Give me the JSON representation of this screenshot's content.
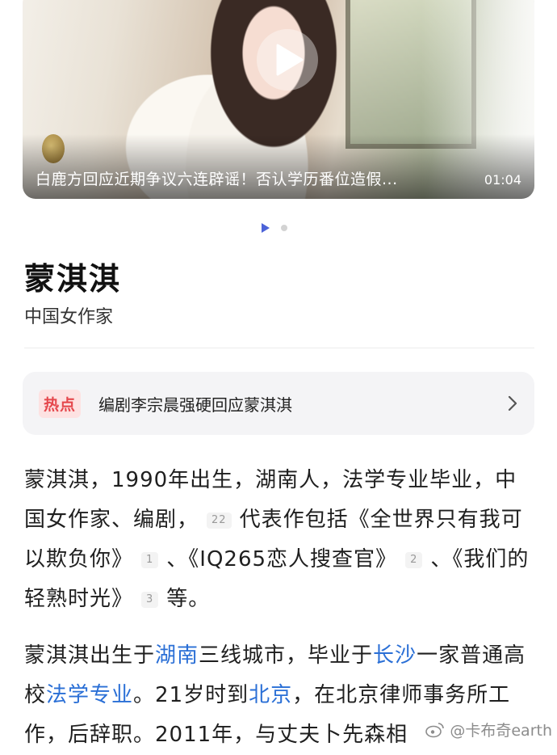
{
  "video": {
    "title": "白鹿方回应近期争议六连辟谣！否认学历番位造假...",
    "duration": "01:04"
  },
  "pager": {
    "total": 2,
    "active_index": 0
  },
  "entity": {
    "name": "蒙淇淇",
    "subtitle": "中国女作家"
  },
  "hot": {
    "badge": "热点",
    "text": "编剧李宗晨强硬回应蒙淇淇"
  },
  "paragraph1": {
    "s1": "蒙淇淇，1990年出生，湖南人，法学专业毕业，中国女作家、编剧，",
    "ref1": "22",
    "s2": "代表作包括《全世界只有我可以欺负你》",
    "ref2": "1",
    "s3": "、《IQ265恋人搜查官》",
    "ref3": "2",
    "s4": "、《我们的轻熟时光》",
    "ref4": "3",
    "s5": "等。"
  },
  "paragraph2": {
    "t1": "蒙淇淇出生于",
    "l1": "湖南",
    "t2": "三线城市，毕业于",
    "l2": "长沙",
    "t3": "一家普通高校",
    "l3": "法学专业",
    "t4": "。21岁时到",
    "l4": "北京",
    "t5": "，在北京律师事务所工作，后辞职。2011年，与丈夫卜先森相"
  },
  "watermark": {
    "text": "@卡布奇earth"
  },
  "colors": {
    "accent": "#4c63d8",
    "link": "#2a6fd6",
    "hot": "#e5484d"
  }
}
